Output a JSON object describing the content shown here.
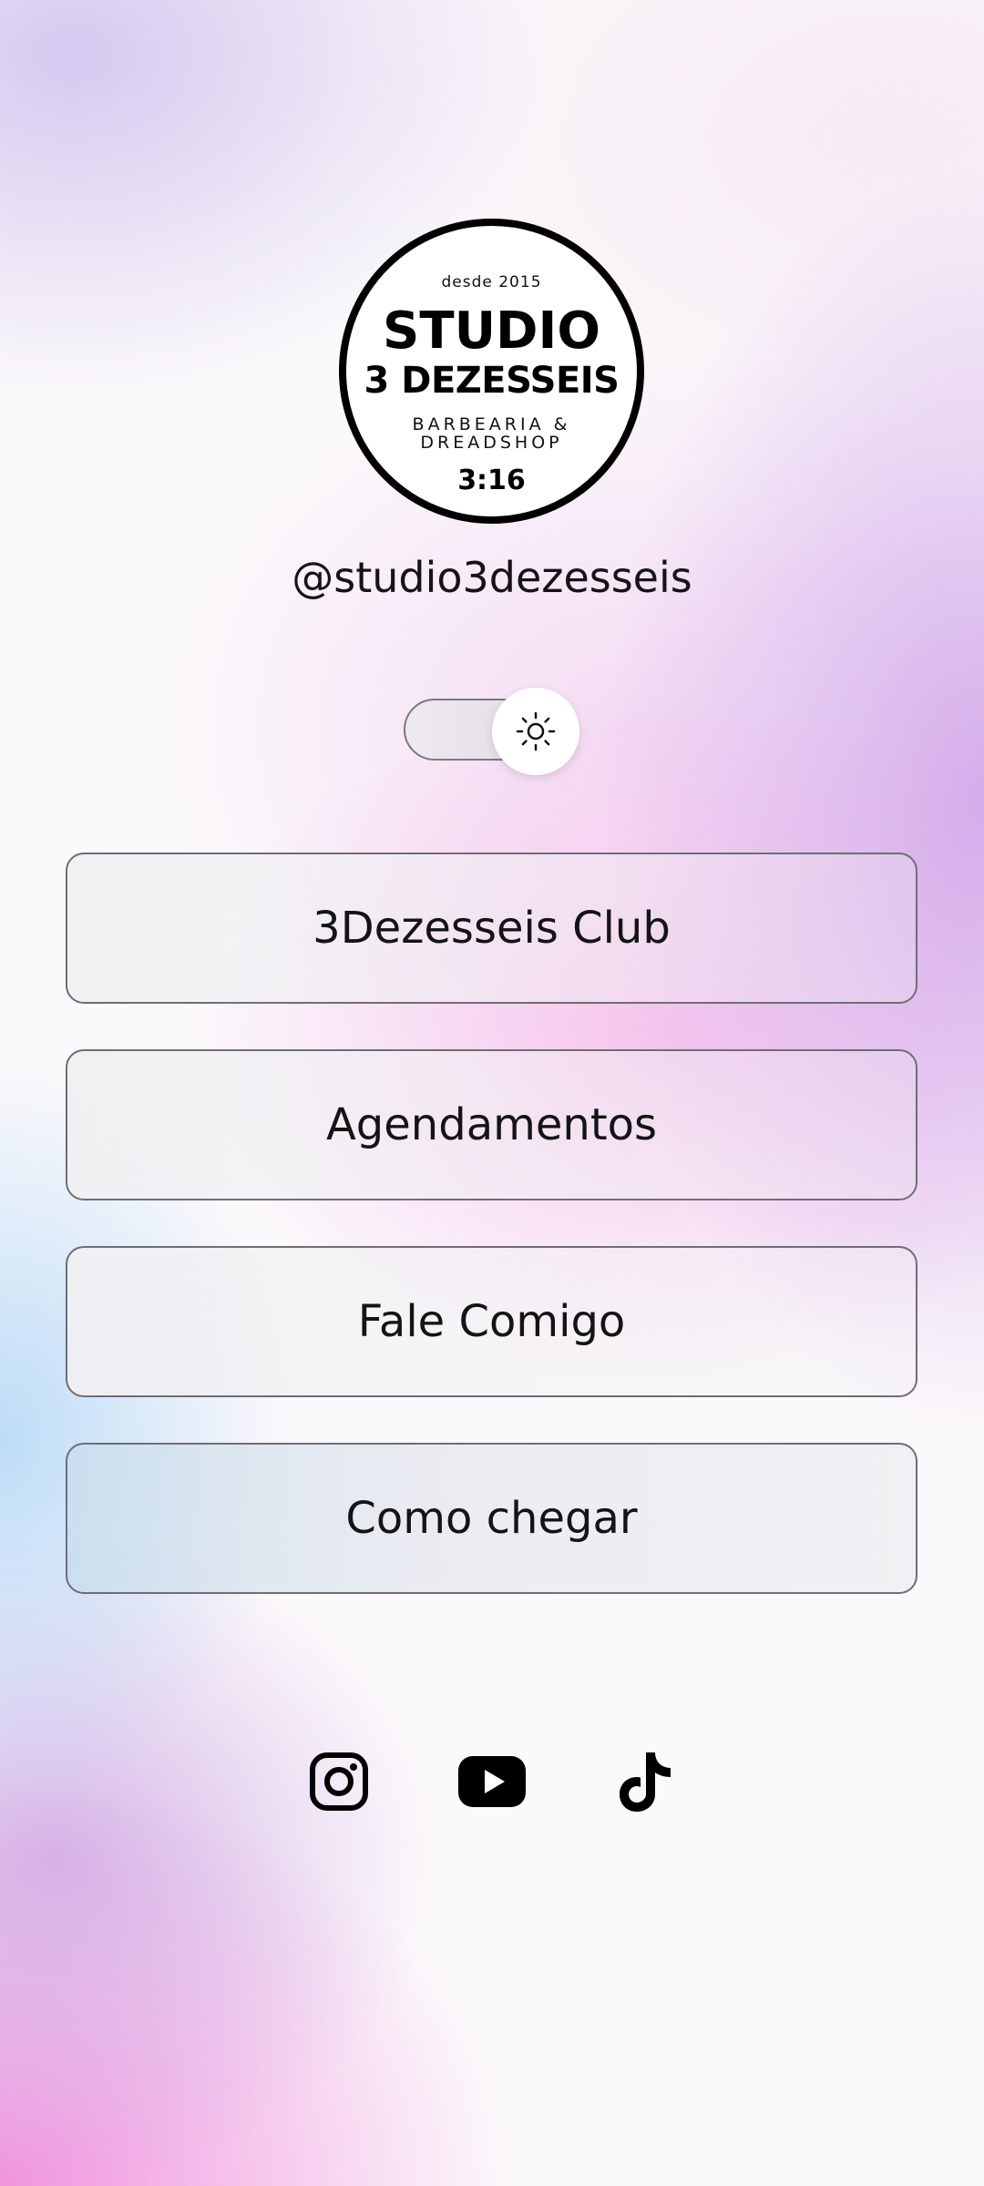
{
  "profile": {
    "logo": {
      "since": "desde 2015",
      "line1": "STUDIO",
      "line2": "3 DEZESSEIS",
      "line3": "BARBEARIA &",
      "line4": "DREADSHOP",
      "line5": "3:16"
    },
    "handle": "@studio3dezesseis"
  },
  "theme_toggle": {
    "icon": "sun-icon",
    "mode": "light"
  },
  "links": [
    {
      "label": "3Dezesseis Club"
    },
    {
      "label": "Agendamentos"
    },
    {
      "label": "Fale Comigo"
    },
    {
      "label": "Como chegar"
    }
  ],
  "socials": [
    {
      "icon": "instagram-icon"
    },
    {
      "icon": "youtube-icon"
    },
    {
      "icon": "tiktok-icon"
    }
  ],
  "colors": {
    "text": "#141414",
    "button_border": "#6e6e74",
    "icon": "#000000"
  }
}
